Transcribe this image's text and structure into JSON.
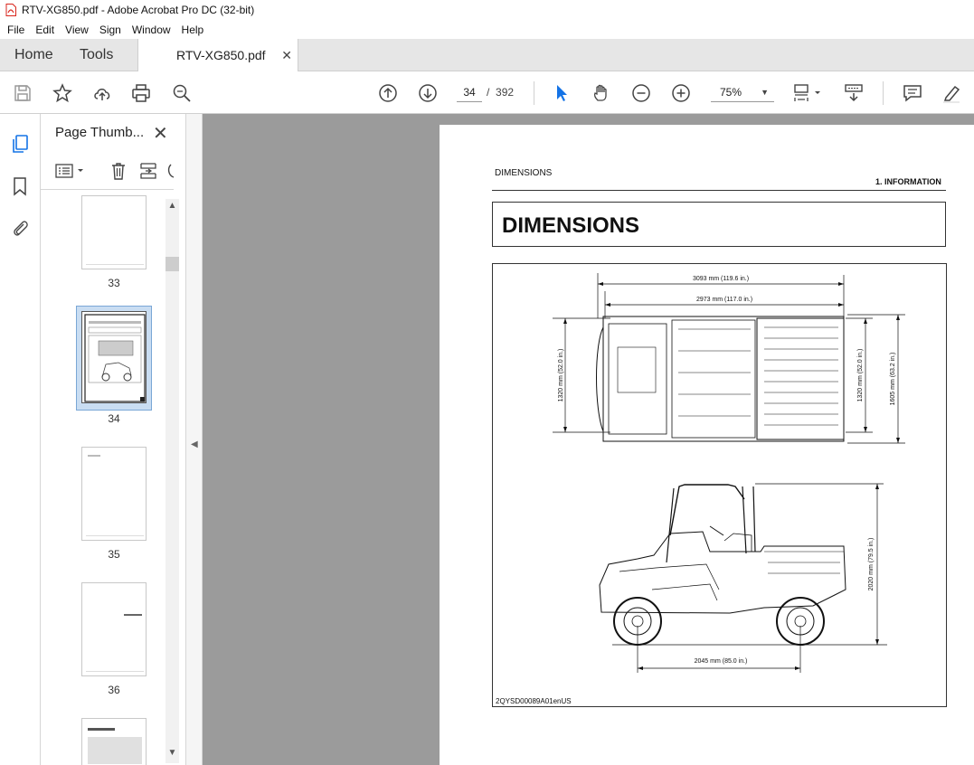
{
  "window": {
    "title": "RTV-XG850.pdf - Adobe Acrobat Pro DC (32-bit)"
  },
  "menu": [
    "File",
    "Edit",
    "View",
    "Sign",
    "Window",
    "Help"
  ],
  "tabs": {
    "home": "Home",
    "tools": "Tools",
    "document": "RTV-XG850.pdf"
  },
  "toolbar": {
    "current_page": "34",
    "page_separator": "/",
    "total_pages": "392",
    "zoom": "75%"
  },
  "thumbnails_panel": {
    "title": "Page Thumb...",
    "pages": [
      {
        "number": "33",
        "selected": false
      },
      {
        "number": "34",
        "selected": true
      },
      {
        "number": "35",
        "selected": false
      },
      {
        "number": "36",
        "selected": false
      }
    ]
  },
  "document_page": {
    "section": "DIMENSIONS",
    "chapter": "1. INFORMATION",
    "title": "DIMENSIONS",
    "figure_code": "2QYSD00089A01enUS",
    "dimensions": {
      "overall_length": "3093 mm (119.6 in.)",
      "body_length": "2973 mm (117.0 in.)",
      "front_track": "1320 mm (52.0 in.)",
      "rear_track": "1320 mm (52.0 in.)",
      "overall_width": "1605 mm (63.2 in.)",
      "overall_height": "2020 mm (79.5 in.)",
      "wheelbase": "2045 mm (85.0 in.)"
    }
  },
  "colors": {
    "accent": "#1473e6",
    "tab_bar": "#e6e6e6",
    "viewer_bg": "#9b9b9b",
    "pdf_icon": "#d9251c"
  }
}
